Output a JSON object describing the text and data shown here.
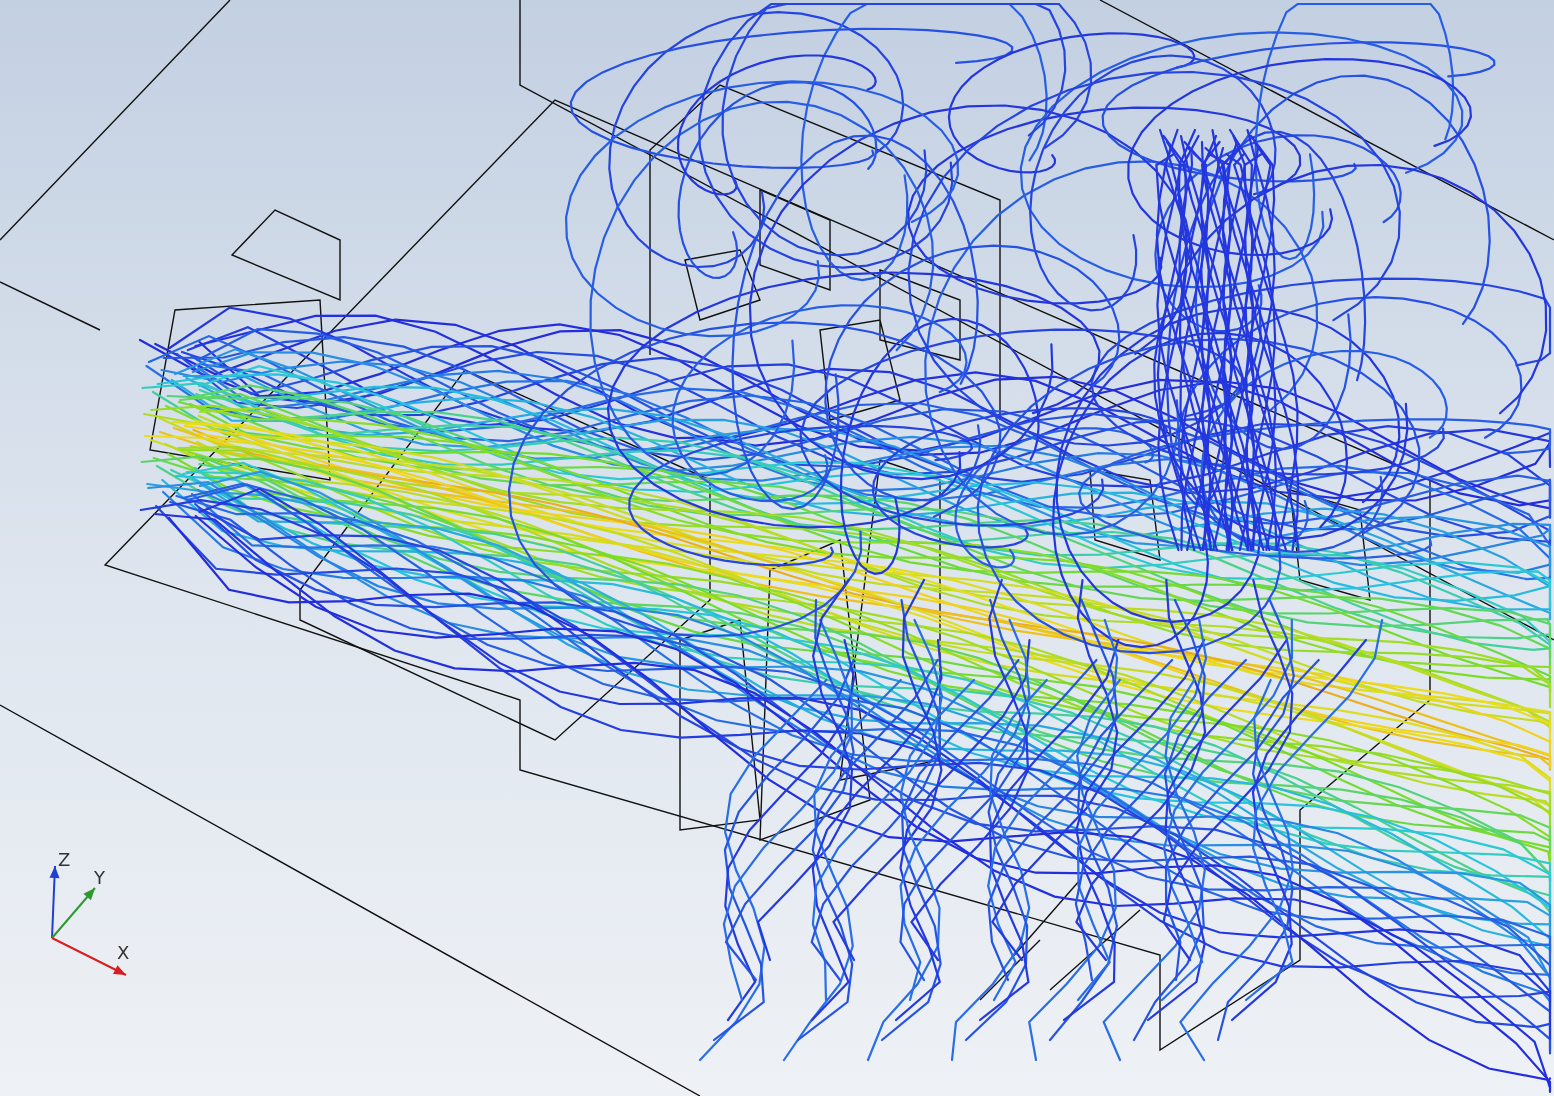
{
  "viewport": {
    "axis_triad": [
      {
        "kind": "z",
        "label": "Z",
        "color": "#1f3fd0"
      },
      {
        "kind": "y",
        "label": "Y",
        "color": "#2e9a2e"
      },
      {
        "kind": "x",
        "label": "X",
        "color": "#d81e1e"
      }
    ]
  }
}
